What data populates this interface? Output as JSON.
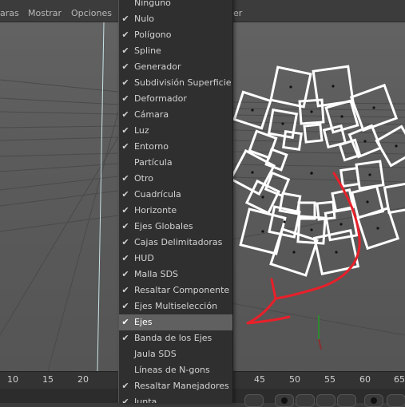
{
  "top_menu": {
    "item_cameras_partial": "aras",
    "item_show": "Mostrar",
    "item_options": "Opciones",
    "item_right_partial": "er"
  },
  "timeline": {
    "ticks_left": [
      "10",
      "15",
      "20"
    ],
    "ticks_right": [
      "45",
      "50",
      "55",
      "60",
      "65"
    ]
  },
  "colors": {
    "accent_annotation": "#e8202a",
    "menu_highlight": "#606060",
    "menu_background": "#2f2f2f"
  },
  "menu": {
    "items": [
      {
        "label": "Ninguno",
        "checked": false
      },
      {
        "label": "Nulo",
        "checked": true
      },
      {
        "label": "Polígono",
        "checked": true
      },
      {
        "label": "Spline",
        "checked": true
      },
      {
        "label": "Generador",
        "checked": true
      },
      {
        "label": "Subdivisión Superficie",
        "checked": true
      },
      {
        "label": "Deformador",
        "checked": true
      },
      {
        "label": "Cámara",
        "checked": true
      },
      {
        "label": "Luz",
        "checked": true
      },
      {
        "label": "Entorno",
        "checked": true
      },
      {
        "label": "Partícula",
        "checked": false
      },
      {
        "label": "Otro",
        "checked": true
      },
      {
        "label": "Cuadrícula",
        "checked": true
      },
      {
        "label": "Horizonte",
        "checked": true
      },
      {
        "label": "Ejes Globales",
        "checked": true
      },
      {
        "label": "Cajas Delimitadoras",
        "checked": true
      },
      {
        "label": "HUD",
        "checked": true
      },
      {
        "label": "Malla SDS",
        "checked": true
      },
      {
        "label": "Resaltar Componente",
        "checked": true
      },
      {
        "label": "Ejes Multiselección",
        "checked": true
      },
      {
        "label": "Ejes",
        "checked": true,
        "highlighted": true
      },
      {
        "label": "Banda de los Ejes",
        "checked": true
      },
      {
        "label": "Jaula SDS",
        "checked": false
      },
      {
        "label": "Líneas de N-gons",
        "checked": false
      },
      {
        "label": "Resaltar Manejadores",
        "checked": true
      },
      {
        "label": "Junta",
        "checked": true
      }
    ]
  }
}
